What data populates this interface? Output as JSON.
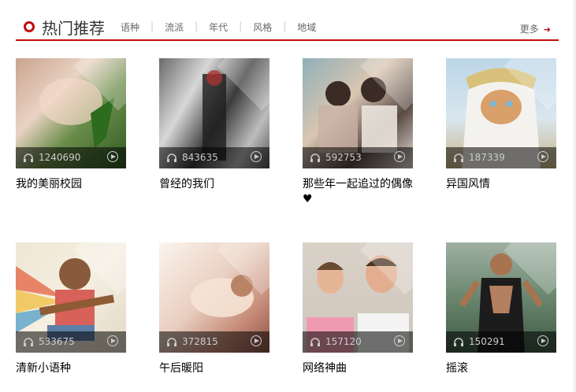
{
  "header": {
    "title": "热门推荐",
    "tabs": [
      "语种",
      "流派",
      "年代",
      "风格",
      "地域"
    ],
    "more_label": "更多"
  },
  "colors": {
    "accent": "#c10d0c"
  },
  "playlists": [
    {
      "name": "我的美丽校园",
      "plays": "1240690",
      "icon": "headset-icon"
    },
    {
      "name": "曾经的我们",
      "plays": "843635",
      "icon": "headset-icon"
    },
    {
      "name": "那些年一起追过的偶像",
      "name_suffix": "♥",
      "plays": "592753",
      "icon": "headset-icon"
    },
    {
      "name": "异国风情",
      "plays": "187339",
      "icon": "headset-icon"
    },
    {
      "name": "清新小语种",
      "plays": "533675",
      "icon": "headset-icon"
    },
    {
      "name": "午后暖阳",
      "plays": "372815",
      "icon": "headset-icon"
    },
    {
      "name": "网络神曲",
      "plays": "157120",
      "icon": "headset-icon"
    },
    {
      "name": "摇滚",
      "plays": "150291",
      "icon": "headset-icon"
    }
  ]
}
